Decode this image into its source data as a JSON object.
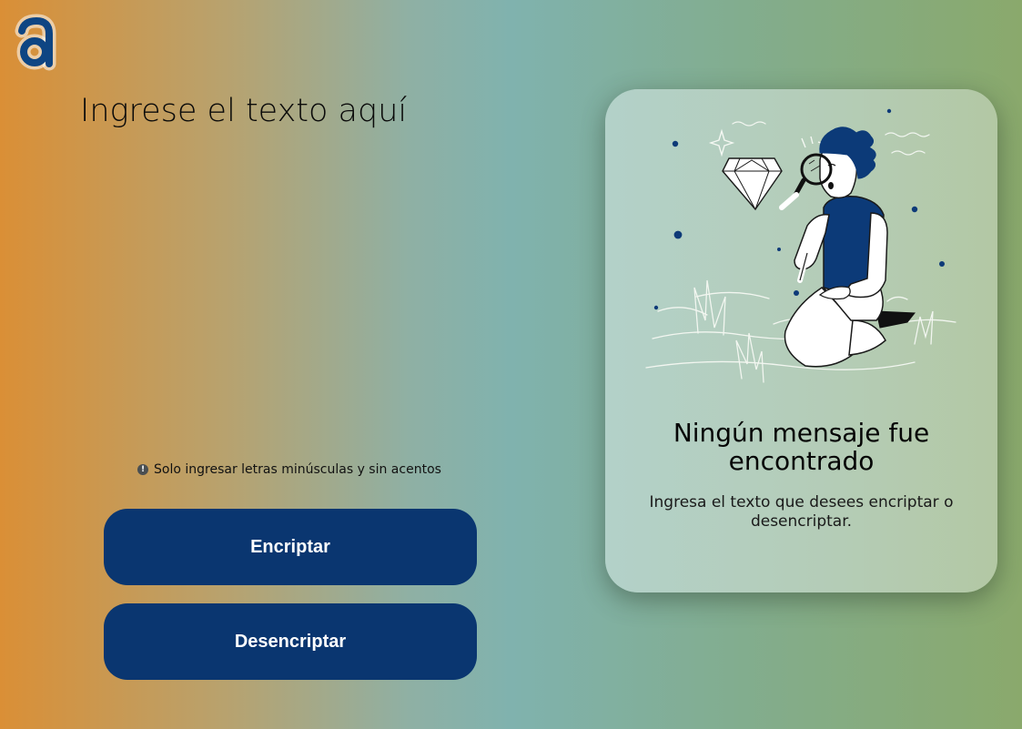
{
  "brand": {
    "logo_icon": "letter-a-logo",
    "color": "#0a3670"
  },
  "input": {
    "placeholder": "Ingrese el texto aquí",
    "value": ""
  },
  "hint": {
    "icon": "info-circle-icon",
    "text": "Solo ingresar letras minúsculas y sin acentos"
  },
  "actions": {
    "encrypt_label": "Encriptar",
    "decrypt_label": "Desencriptar",
    "button_color": "#0a3670"
  },
  "output": {
    "illustration": "person-with-magnifying-glass-illustration",
    "title": "Ningún mensaje fue encontrado",
    "description": "Ingresa el texto que desees encriptar o desencriptar."
  }
}
